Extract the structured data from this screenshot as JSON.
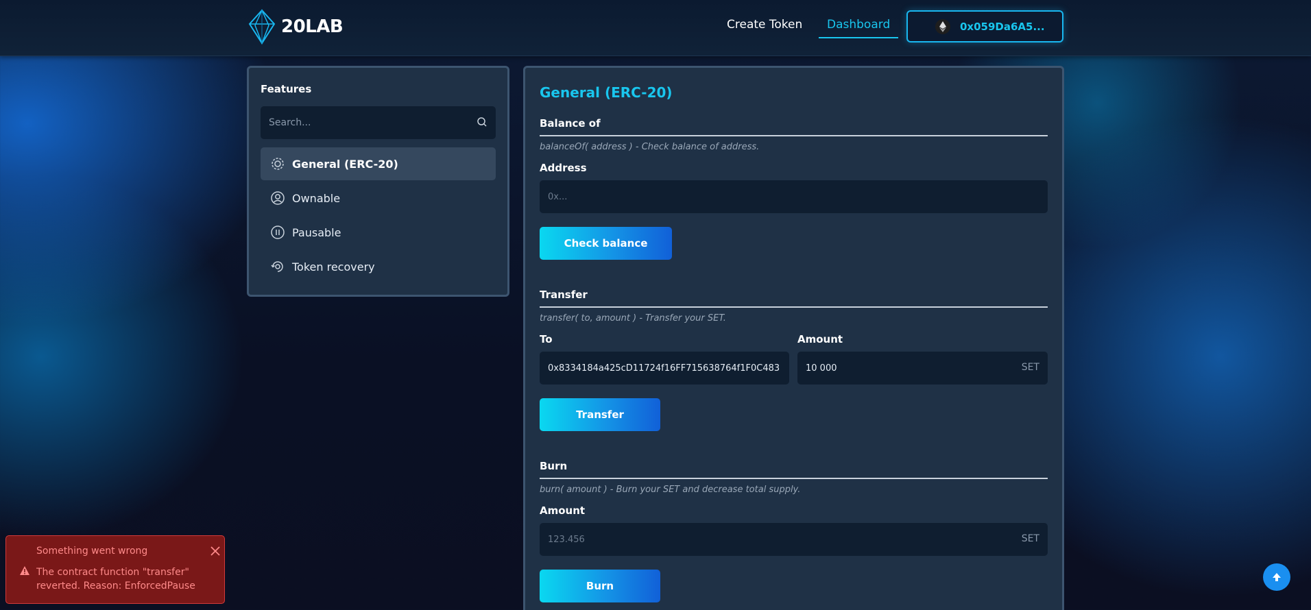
{
  "header": {
    "logo_text": "20LAB",
    "nav": {
      "create_token": "Create Token",
      "dashboard": "Dashboard"
    },
    "wallet_address": "0x059Da6A5..."
  },
  "sidebar": {
    "title": "Features",
    "search_placeholder": "Search...",
    "items": [
      {
        "label": "General (ERC-20)",
        "icon": "gear-icon",
        "active": true
      },
      {
        "label": "Ownable",
        "icon": "user-circle-icon",
        "active": false
      },
      {
        "label": "Pausable",
        "icon": "pause-circle-icon",
        "active": false
      },
      {
        "label": "Token recovery",
        "icon": "recovery-icon",
        "active": false
      }
    ]
  },
  "main": {
    "title": "General (ERC-20)",
    "balance": {
      "title": "Balance of",
      "description": "balanceOf( address ) - Check balance of address.",
      "address_label": "Address",
      "address_placeholder": "0x...",
      "button": "Check balance"
    },
    "transfer": {
      "title": "Transfer",
      "description": "transfer( to, amount ) - Transfer your SET.",
      "to_label": "To",
      "to_value": "0x8334184a425cD11724f16FF715638764f1F0C483",
      "amount_label": "Amount",
      "amount_value": "10 000",
      "unit": "SET",
      "button": "Transfer"
    },
    "burn": {
      "title": "Burn",
      "description": "burn( amount ) - Burn your SET and decrease total supply.",
      "amount_label": "Amount",
      "amount_placeholder": "123.456",
      "unit": "SET",
      "button": "Burn"
    }
  },
  "toast": {
    "title": "Something went wrong",
    "message": "The contract function \"transfer\" reverted. Reason: EnforcedPause"
  },
  "colors": {
    "accent": "#19c6ee",
    "card": "#1f3146",
    "error_bg": "#7a1818",
    "error_text": "#ff8a8a"
  }
}
